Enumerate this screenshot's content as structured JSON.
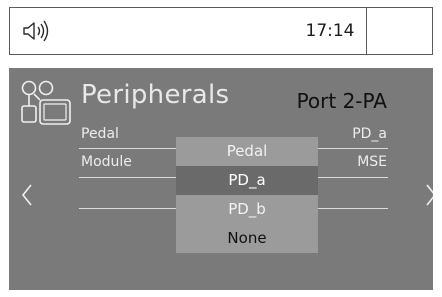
{
  "status": {
    "time": "17:14",
    "volume_icon": "speaker-icon"
  },
  "page": {
    "title": "Peripherals",
    "port": "Port 2-PA",
    "icon": "peripherals-icon"
  },
  "fields": {
    "left_row1": "Pedal",
    "left_row2": "Module",
    "right_row1": "PD_a",
    "right_row2": "MSE"
  },
  "dropdown": {
    "options": [
      "Pedal",
      "PD_a",
      "PD_b",
      "None"
    ],
    "selected_index": 1
  },
  "nav": {
    "prev_icon": "chevron-left-icon",
    "next_icon": "chevron-right-icon"
  },
  "colors": {
    "screen_bg": "#7a7a7a",
    "selected_bg": "#6a6a6a",
    "dropdown_bg": "#9b9b9b"
  }
}
